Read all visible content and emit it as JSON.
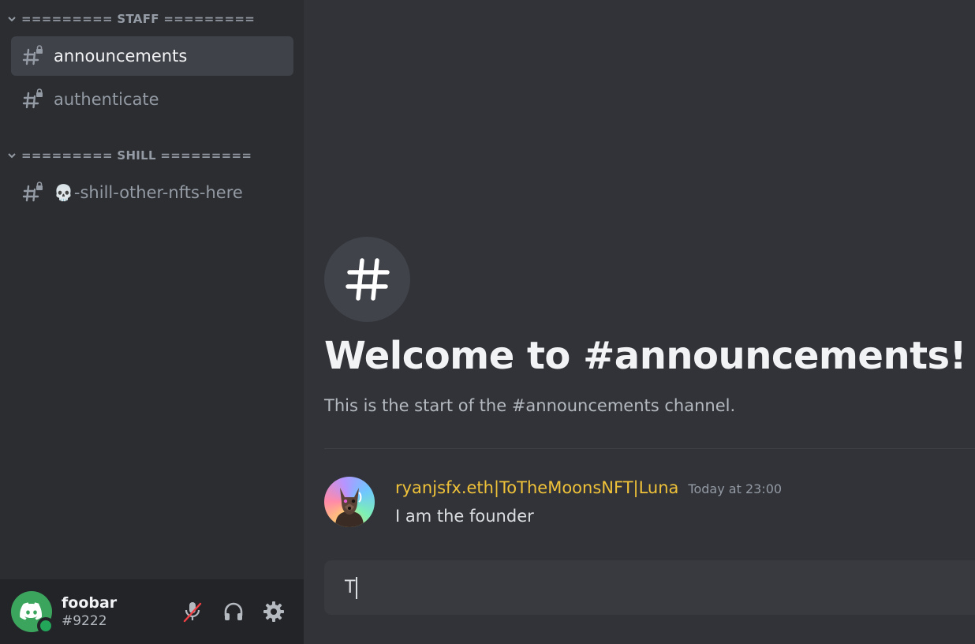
{
  "sidebar": {
    "categories": [
      {
        "label": "========= STAFF =========",
        "icon": "chevron-down-icon"
      },
      {
        "label": "========= SHILL =========",
        "icon": "chevron-down-icon"
      }
    ],
    "channels": [
      {
        "name": "announcements",
        "icon": "locked-hash-icon",
        "active": true
      },
      {
        "name": "authenticate",
        "icon": "locked-hash-icon",
        "active": false
      },
      {
        "emoji": "💀",
        "name": "-shill-other-nfts-here",
        "icon": "locked-hash-icon",
        "active": false
      }
    ]
  },
  "user_panel": {
    "username": "foobar",
    "discriminator": "#9222",
    "status": "online",
    "buttons": [
      "mute-mic-icon",
      "headphones-icon",
      "gear-icon"
    ]
  },
  "main": {
    "welcome": {
      "title": "Welcome to #announcements!",
      "subtitle": "This is the start of the #announcements channel."
    },
    "messages": [
      {
        "author": "ryanjsfx.eth|ToTheMoonsNFT|Luna",
        "timestamp": "Today at 23:00",
        "text": "I am the founder"
      }
    ],
    "composer": {
      "value": "T"
    }
  },
  "colors": {
    "sidebar_bg": "#2b2d31",
    "main_bg": "#313338",
    "active_channel_bg": "#404249",
    "author_name": "#f0c239",
    "online_green": "#23a55a",
    "muted_red": "#f23f43"
  }
}
